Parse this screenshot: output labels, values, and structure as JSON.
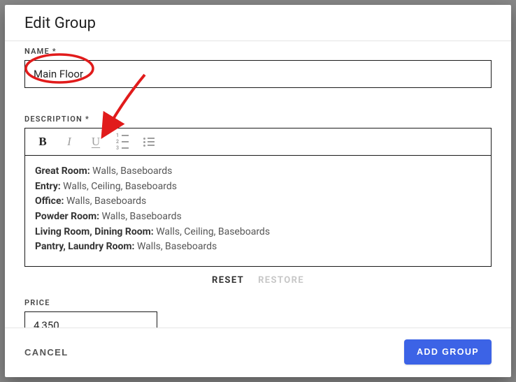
{
  "header": {
    "title": "Edit Group"
  },
  "name": {
    "label": "NAME *",
    "value": "Main Floor"
  },
  "description": {
    "label": "DESCRIPTION *",
    "lines": [
      {
        "label": "Great Room:",
        "text": " Walls, Baseboards"
      },
      {
        "label": "Entry:",
        "text": " Walls, Ceiling, Baseboards"
      },
      {
        "label": "Office:",
        "text": " Walls, Baseboards"
      },
      {
        "label": "Powder Room:",
        "text": " Walls, Baseboards"
      },
      {
        "label": "Living Room, Dining Room:",
        "text": " Walls, Ceiling, Baseboards"
      },
      {
        "label": "Pantry, Laundry Room:",
        "text": " Walls, Baseboards"
      }
    ],
    "reset": "RESET",
    "restore": "RESTORE"
  },
  "toolbar": {
    "bold": "B",
    "italic": "I",
    "underline": "U"
  },
  "price": {
    "label": "PRICE",
    "value": "4,350"
  },
  "footer": {
    "cancel": "CANCEL",
    "submit": "ADD GROUP"
  },
  "annotation": {
    "color": "#e11b1b"
  }
}
